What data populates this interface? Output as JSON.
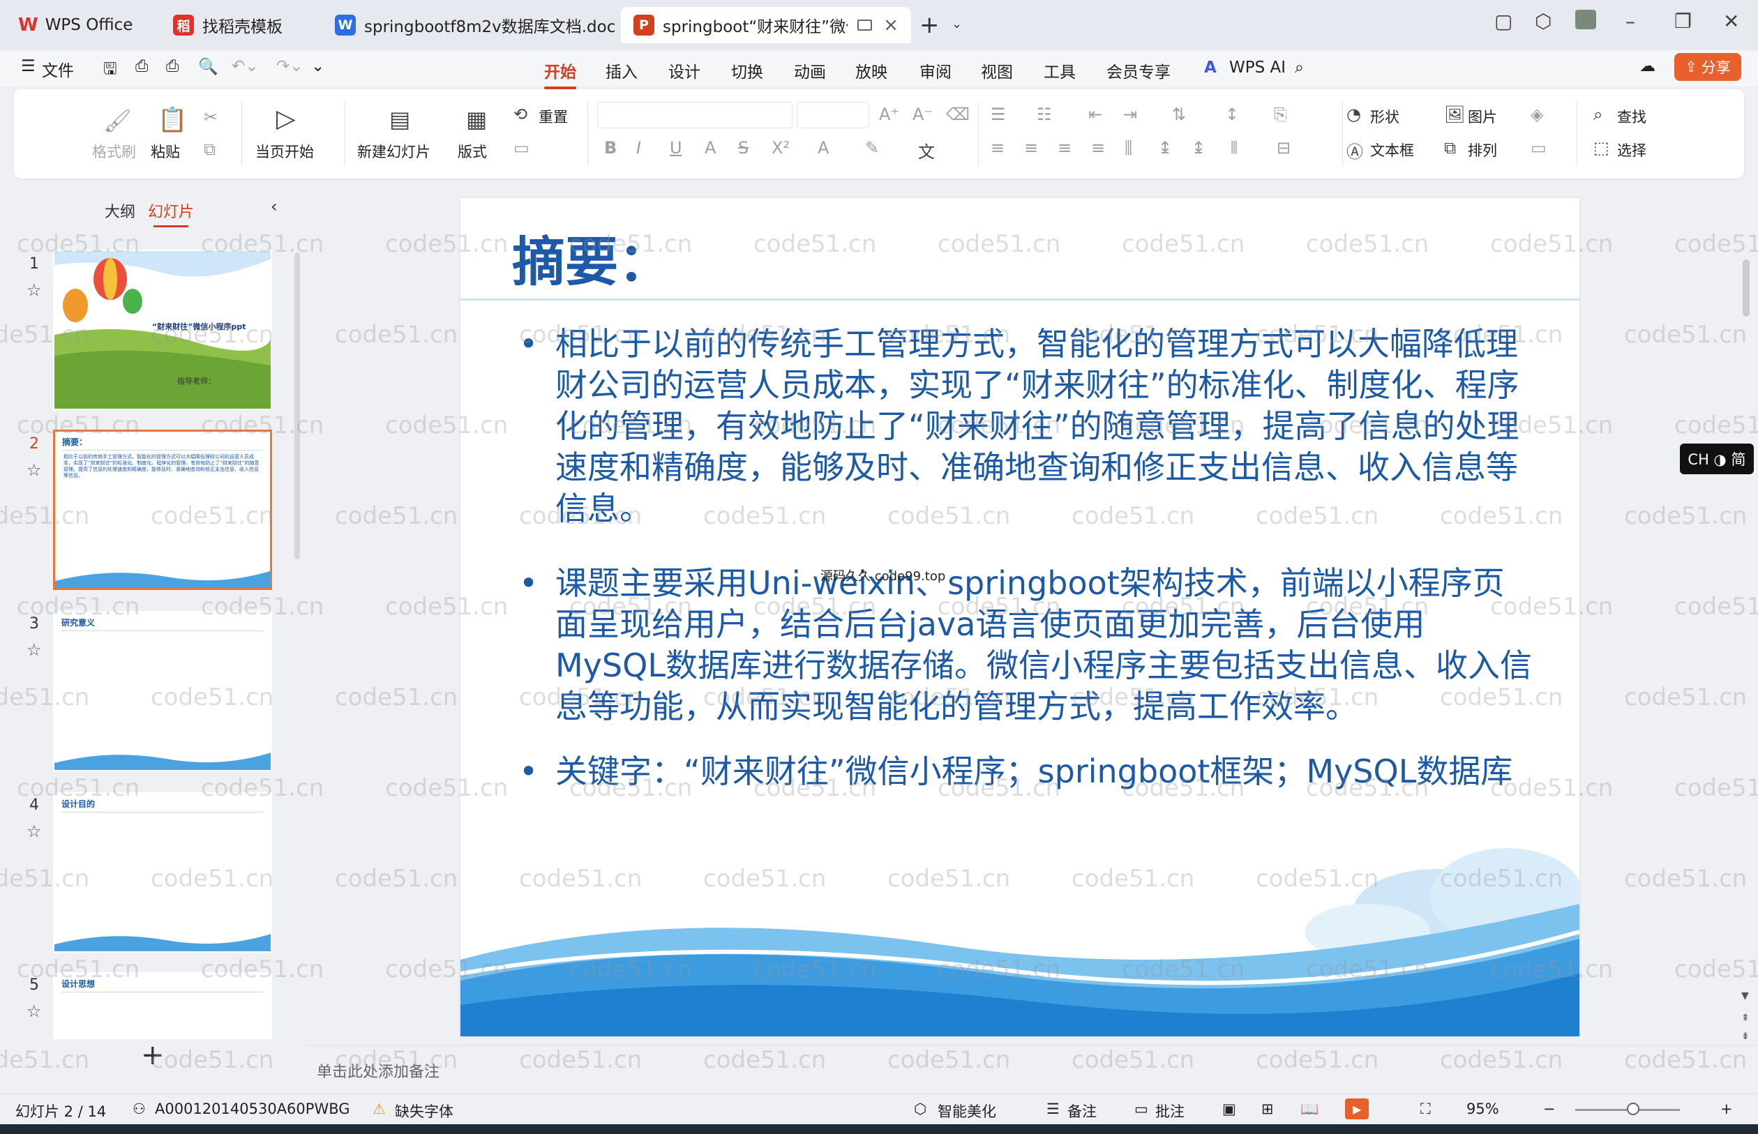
{
  "tabs": [
    {
      "label": "WPS Office",
      "icon": "wps-logo-icon",
      "color": "#e0322b"
    },
    {
      "label": "找稻壳模板",
      "icon": "docer-icon",
      "color": "#e0322b"
    },
    {
      "label": "springbootf8m2v数据库文档.doc",
      "icon": "word-doc-icon",
      "color": "#2f6fe4"
    },
    {
      "label": "springboot“财来财往”微信",
      "icon": "ppt-doc-icon",
      "color": "#d2401e"
    }
  ],
  "menu": {
    "file": "文件",
    "tabs": [
      "开始",
      "插入",
      "设计",
      "切换",
      "动画",
      "放映",
      "审阅",
      "视图",
      "工具",
      "会员专享"
    ],
    "active_tab": "开始",
    "wps_ai": "WPS AI",
    "share": "分享"
  },
  "ribbon": {
    "format_painter": "格式刷",
    "paste": "粘贴",
    "play_from_current": "当页开始",
    "new_slide": "新建幻灯片",
    "layout": "版式",
    "reset": "重置",
    "shape": "形状",
    "picture": "图片",
    "find": "查找",
    "textbox": "文本框",
    "arrange": "排列",
    "select": "选择"
  },
  "left_panel": {
    "tab_outline": "大纲",
    "tab_slides": "幻灯片",
    "slides": [
      {
        "num": "1",
        "title": "“财来财往”微信小程序ppt",
        "subtitle": "指导老师："
      },
      {
        "num": "2",
        "title": "摘要："
      },
      {
        "num": "3",
        "title": "研究意义"
      },
      {
        "num": "4",
        "title": "设计目的"
      },
      {
        "num": "5",
        "title": "设计思想"
      }
    ],
    "selected": "2"
  },
  "slide": {
    "title": "摘要：",
    "bullets": [
      "相比于以前的传统手工管理方式，智能化的管理方式可以大幅降低理财公司的运营人员成本，实现了“财来财往”的标准化、制度化、程序化的管理，有效地防止了“财来财往”的随意管理，提高了信息的处理速度和精确度，能够及时、准确地查询和修正支出信息、收入信息等信息。",
      "课题主要采用Uni-weixin、springboot架构技术，前端以小程序页面呈现给用户，结合后台java语言使页面更加完善，后台使用MySQL数据库进行数据存储。微信小程序主要包括支出信息、收入信息等功能，从而实现智能化的管理方式，提高工作效率。",
      "关键字：“财来财往”微信小程序；springboot框架；MySQL数据库"
    ],
    "inline_watermark": "源码久久 code99.top"
  },
  "ime_badge": "CH ◑ 简",
  "notes_placeholder": "单击此处添加备注",
  "status": {
    "slide_counter": "幻灯片 2 / 14",
    "doc_id": "A000120140530A60PWBG",
    "missing_font": "缺失字体",
    "smart_beautify": "智能美化",
    "notes": "备注",
    "comments": "批注",
    "zoom": "95%",
    "zoom_fraction": 0.55
  },
  "watermark_text": "code51.cn",
  "colors": {
    "accent": "#d2401e",
    "slide_blue": "#1c5aa8",
    "share": "#e8612c"
  }
}
